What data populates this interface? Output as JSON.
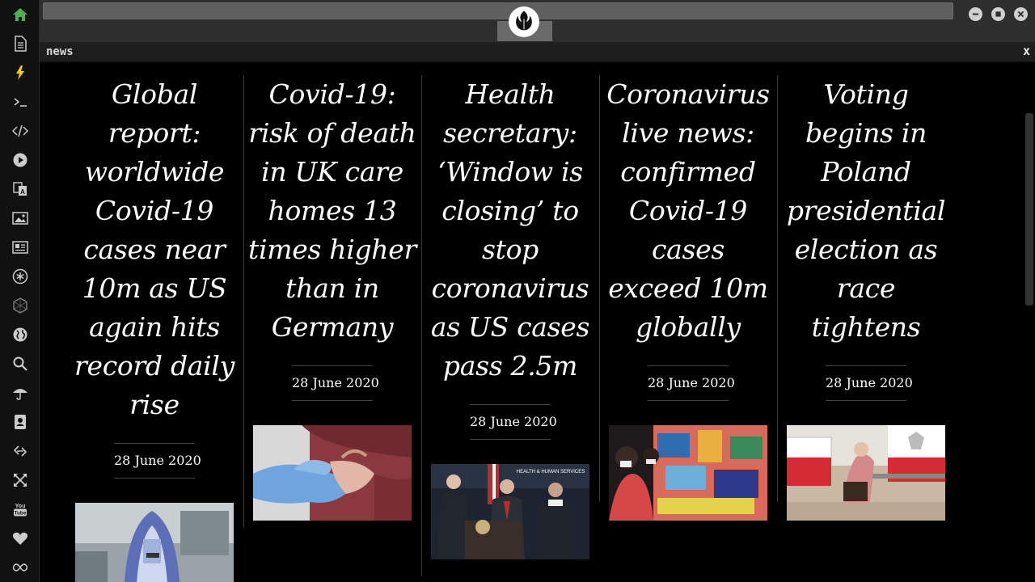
{
  "app": {
    "panel_title": "news",
    "close_label": "x"
  },
  "sidebar": {
    "icons": [
      "home-icon",
      "document-icon",
      "bolt-icon",
      "terminal-icon",
      "code-icon",
      "play-icon",
      "translate-icon",
      "image-icon",
      "newspaper-icon",
      "asterisk-icon",
      "hexagon-icon",
      "globe-icon",
      "search-icon",
      "umbrella-icon",
      "contact-icon",
      "link-icon",
      "expand-icon",
      "youtube-icon",
      "heart-icon",
      "infinity-icon"
    ],
    "youtube_text": "You\nTube",
    "accent_home": "#4caf50",
    "accent_bolt": "#f5d000"
  },
  "articles": [
    {
      "headline": "Global report: worldwide Covid-19 cases near 10m as US again hits record daily rise",
      "date": "28 June 2020",
      "image": "testing-worker-in-protective-suit"
    },
    {
      "headline": "Covid-19: risk of death in UK care homes 13 times higher than in Germany",
      "date": "28 June 2020",
      "image": "gloved-hand-holding-elderly-hand"
    },
    {
      "headline": "Health secretary: ‘Window is closing’ to stop coronavirus as US cases pass 2.5m",
      "date": "28 June 2020",
      "image": "officials-at-podium"
    },
    {
      "headline": "Coronavirus live news: confirmed Covid-19 cases exceed 10m globally",
      "date": "28 June 2020",
      "image": "masked-people-before-mural"
    },
    {
      "headline": "Voting begins in Poland presidential election as race tightens",
      "date": "28 June 2020",
      "image": "voter-at-booth"
    }
  ],
  "podium_sign": "HEALTH & HUMAN SERVICES"
}
